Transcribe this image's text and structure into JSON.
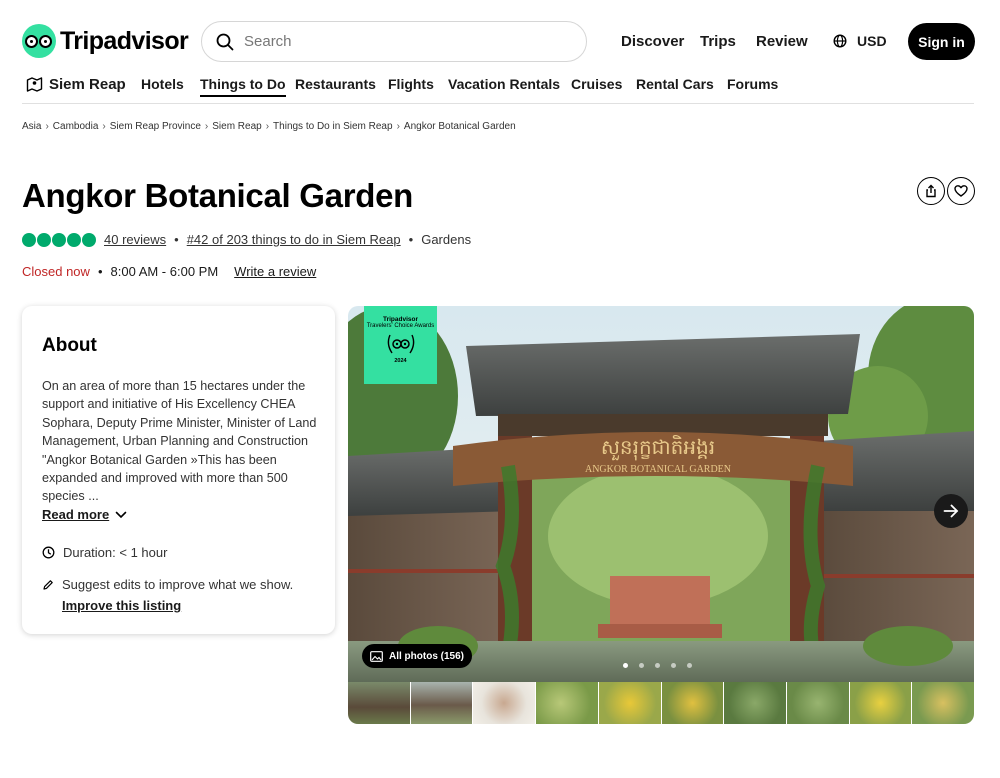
{
  "header": {
    "brand": "Tripadvisor",
    "search_placeholder": "Search",
    "nav": [
      "Discover",
      "Trips",
      "Review"
    ],
    "currency": "USD",
    "signin_label": "Sign in"
  },
  "subnav": {
    "place": "Siem Reap",
    "items": [
      "Hotels",
      "Things to Do",
      "Restaurants",
      "Flights",
      "Vacation Rentals",
      "Cruises",
      "Rental Cars",
      "Forums"
    ],
    "active": "Things to Do"
  },
  "breadcrumb": [
    "Asia",
    "Cambodia",
    "Siem Reap Province",
    "Siem Reap",
    "Things to Do in Siem Reap",
    "Angkor Botanical Garden"
  ],
  "attraction": {
    "title": "Angkor Botanical Garden",
    "rating_bubbles": 5,
    "reviews": "40 reviews",
    "rank": "#42 of 203 things to do in Siem Reap",
    "category": "Gardens",
    "status": "Closed now",
    "hours": "8:00 AM - 6:00 PM",
    "write_review": "Write a review"
  },
  "about": {
    "heading": "About",
    "description": "On an area of more than 15 hectares under the support and initiative of His Excellency CHEA Sophara, Deputy Prime Minister, Minister of Land Management, Urban Planning and Construction \"Angkor Botanical Garden »This has been expanded and improved with more than 500 species ...",
    "read_more": "Read more",
    "duration": "Duration: < 1 hour",
    "suggest": "Suggest edits to improve what we show.",
    "improve": "Improve this listing"
  },
  "gallery": {
    "badge_brand": "Tripadvisor",
    "badge_title": "Travelers' Choice Awards",
    "badge_year": "2024",
    "sign_khmer": "សួនរុក្ខជាតិអង្គរ",
    "sign_text": "ANGKOR BOTANICAL GARDEN",
    "all_photos": "All photos (156)",
    "dots_total": 5,
    "dot_active": 1,
    "thumb_count": 10
  },
  "colors": {
    "brand_green": "#34e0a1",
    "rating_green": "#00aa6c",
    "closed_red": "#c02626"
  }
}
